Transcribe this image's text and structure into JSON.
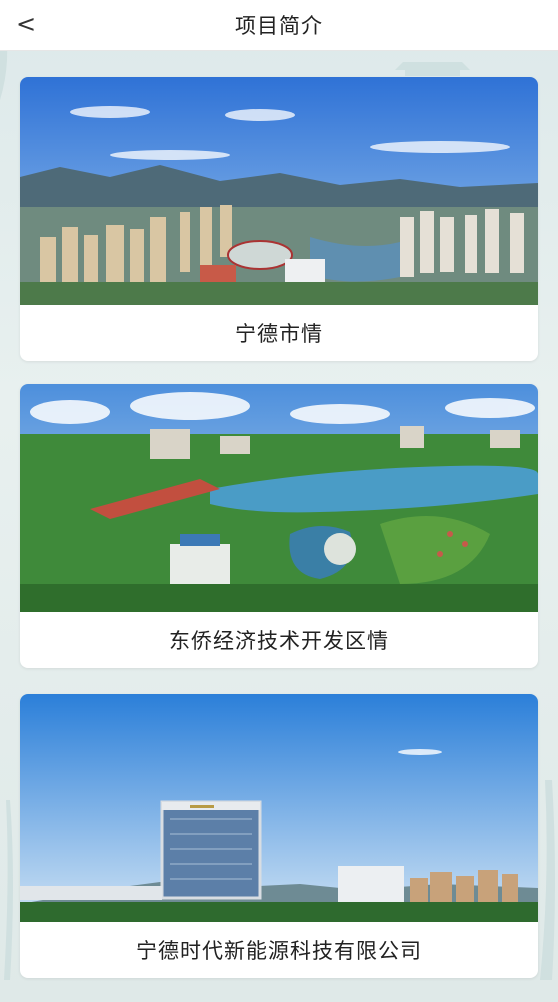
{
  "header": {
    "back_label": "<",
    "title": "项目简介"
  },
  "cards": [
    {
      "caption": "宁德市情"
    },
    {
      "caption": "东侨经济技术开发区情"
    },
    {
      "caption": "宁德时代新能源科技有限公司"
    }
  ],
  "icons": {
    "back": "chevron-left-icon"
  },
  "colors": {
    "header_bg": "#ffffff",
    "page_bg": "#e3eded",
    "text": "#222222"
  }
}
